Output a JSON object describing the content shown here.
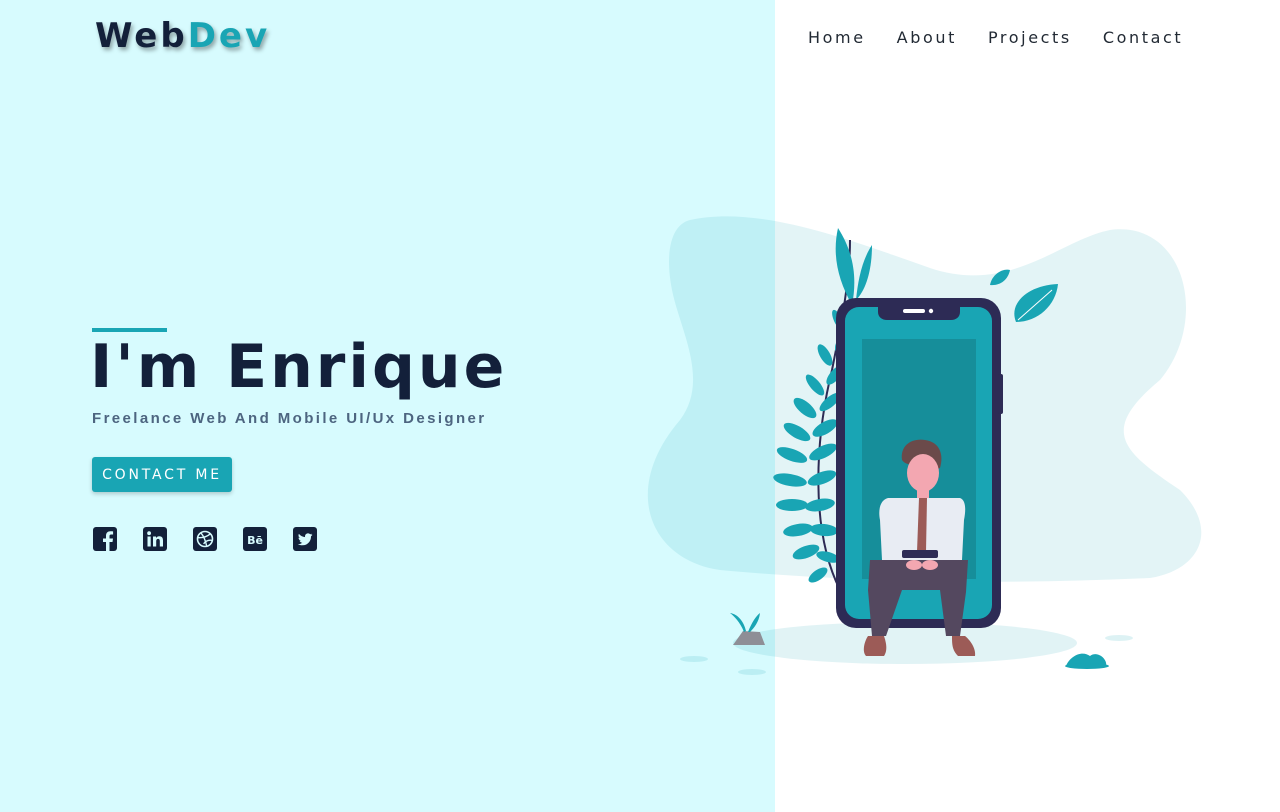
{
  "brand": {
    "part1": "Web",
    "part2": "Dev"
  },
  "nav": {
    "items": [
      "Home",
      "About",
      "Projects",
      "Contact"
    ]
  },
  "hero": {
    "title": "I'm Enrique",
    "subtitle": "Freelance Web And Mobile UI/Ux Designer",
    "cta_label": "CONTACT ME"
  },
  "socials": [
    "facebook-icon",
    "linkedin-icon",
    "dribbble-icon",
    "behance-icon",
    "twitter-icon"
  ],
  "colors": {
    "accent": "#19a5b4",
    "dark": "#13203a",
    "left_background": "#d7fbfe",
    "subtitle": "#4d6580"
  }
}
